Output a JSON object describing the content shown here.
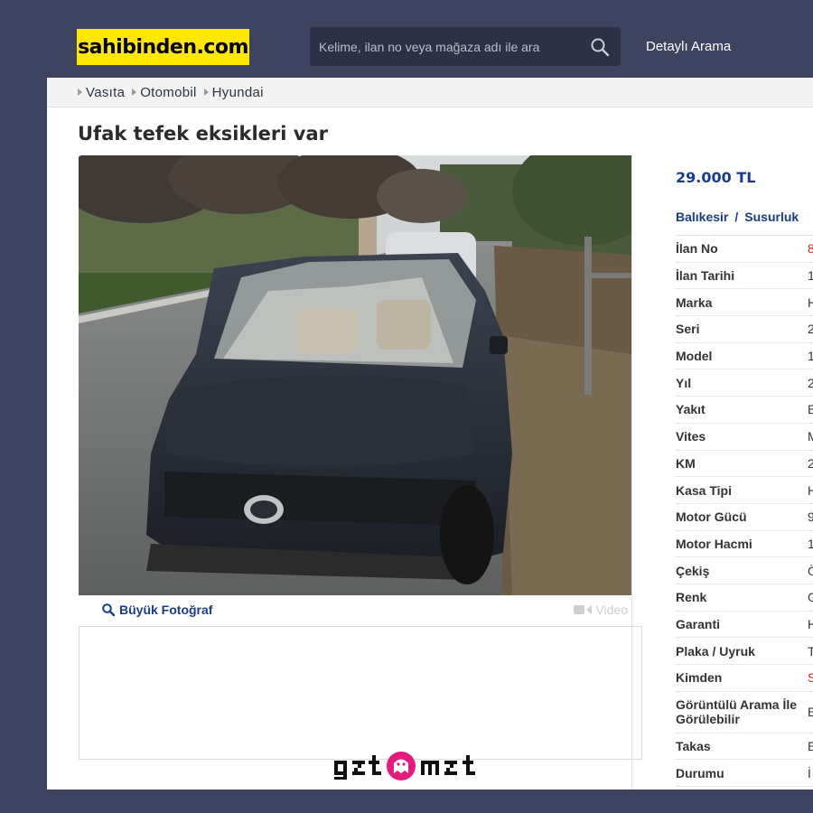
{
  "header": {
    "logo_text": "sahibinden.com",
    "search_placeholder": "Kelime, ilan no veya mağaza adı ile ara",
    "detail_search_label": "Detaylı Arama"
  },
  "breadcrumb": [
    "Vasıta",
    "Otomobil",
    "Hyundai"
  ],
  "listing": {
    "title": "Ufak tefek eksikleri var",
    "big_photo_label": "Büyük Fotoğraf",
    "video_label": "Video",
    "price": "29.000 TL",
    "location": {
      "city": "Balıkesir",
      "separator": "/",
      "district": "Susurluk"
    },
    "attributes": [
      {
        "key": "İlan No",
        "value": "8",
        "highlight": true
      },
      {
        "key": "İlan Tarihi",
        "value": "1"
      },
      {
        "key": "Marka",
        "value": "H"
      },
      {
        "key": "Seri",
        "value": "2"
      },
      {
        "key": "Model",
        "value": "1"
      },
      {
        "key": "Yıl",
        "value": "2"
      },
      {
        "key": "Yakıt",
        "value": "B"
      },
      {
        "key": "Vites",
        "value": "M"
      },
      {
        "key": "KM",
        "value": "2"
      },
      {
        "key": "Kasa Tipi",
        "value": "H"
      },
      {
        "key": "Motor Gücü",
        "value": "9"
      },
      {
        "key": "Motor Hacmi",
        "value": "1"
      },
      {
        "key": "Çekiş",
        "value": "Ö"
      },
      {
        "key": "Renk",
        "value": "G"
      },
      {
        "key": "Garanti",
        "value": "H"
      },
      {
        "key": "Plaka / Uyruk",
        "value": "T"
      },
      {
        "key": "Kimden",
        "value": "S",
        "highlight": true
      },
      {
        "key": "Görüntülü Arama İle Görülebilir",
        "value": "E"
      },
      {
        "key": "Takas",
        "value": "E"
      },
      {
        "key": "Durumu",
        "value": "İ"
      }
    ]
  },
  "watermark": "gzt",
  "colors": {
    "accent": "#1a3c8c",
    "logo_bg": "#ffe800",
    "background": "#3e4460",
    "highlight": "#cc1f1f"
  }
}
